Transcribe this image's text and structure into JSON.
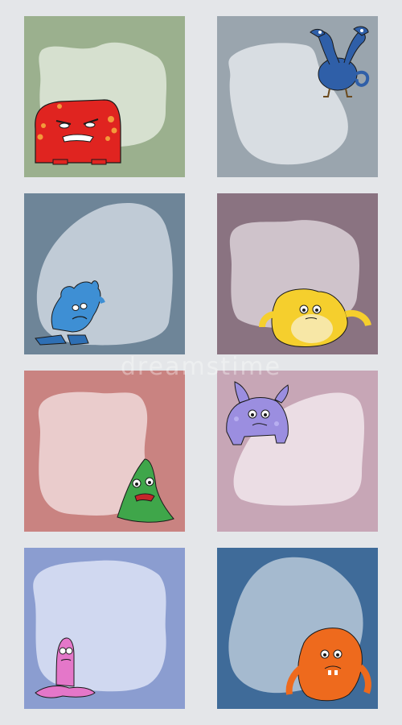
{
  "cards": [
    {
      "name": "red-monster-card",
      "bg": "#9bb08e",
      "blob": "#d6e0cf",
      "monster": "red-box-monster"
    },
    {
      "name": "blue-dragon-card",
      "bg": "#9aa5ae",
      "blob": "#d8dde2",
      "monster": "two-headed-blue-dragon"
    },
    {
      "name": "blue-flame-monster-card",
      "bg": "#6e8598",
      "blob": "#c0cbd6",
      "monster": "blue-flame-monster"
    },
    {
      "name": "yellow-furry-monster-card",
      "bg": "#8a7381",
      "blob": "#cfc3cb",
      "monster": "yellow-furry-monster"
    },
    {
      "name": "green-monster-card",
      "bg": "#c98381",
      "blob": "#eacccc",
      "monster": "green-triangle-monster"
    },
    {
      "name": "purple-monster-card",
      "bg": "#c7a6b6",
      "blob": "#ebdde4",
      "monster": "purple-horned-monster"
    },
    {
      "name": "pink-slime-monster-card",
      "bg": "#8b9dd0",
      "blob": "#d0d8f0",
      "monster": "pink-slime-monster"
    },
    {
      "name": "orange-furry-monster-card",
      "bg": "#3f6b99",
      "blob": "#a5bacf",
      "monster": "orange-furry-monster"
    }
  ],
  "watermark": "dreamstime"
}
